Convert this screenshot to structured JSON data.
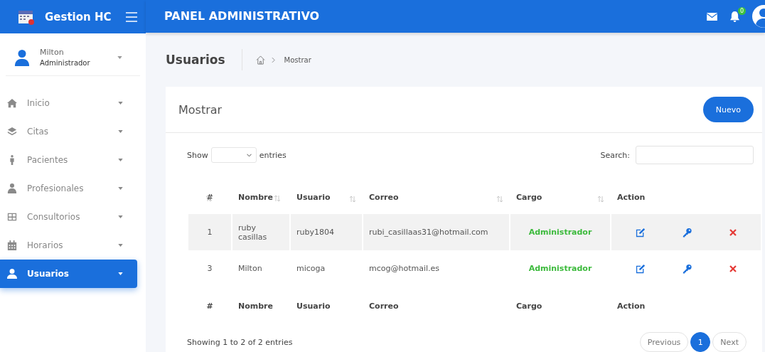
{
  "brand": "Gestion HC",
  "header": {
    "title": "PANEL ADMINISTRATIVO",
    "notifications": "0"
  },
  "user": {
    "name": "Milton",
    "role": "Administrador"
  },
  "nav": [
    {
      "label": "Inicio",
      "selected": false
    },
    {
      "label": "Citas",
      "selected": false
    },
    {
      "label": "Pacientes",
      "selected": false
    },
    {
      "label": "Profesionales",
      "selected": false
    },
    {
      "label": "Consultorios",
      "selected": false
    },
    {
      "label": "Horarios",
      "selected": false
    },
    {
      "label": "Usuarios",
      "selected": true
    }
  ],
  "page": {
    "title": "Usuarios",
    "breadcrumb": "Mostrar"
  },
  "card": {
    "title": "Mostrar",
    "button": "Nuevo"
  },
  "controls": {
    "show": "Show",
    "entries": "entries",
    "search": "Search:"
  },
  "table": {
    "columns": [
      "#",
      "Nombre",
      "Usuario",
      "Correo",
      "Cargo",
      "Action"
    ],
    "rows": [
      {
        "cells": [
          "1",
          "ruby casillas",
          "ruby1804",
          "rubi_casillaas31@hotmail.com",
          "Administrador"
        ],
        "striped": true
      },
      {
        "cells": [
          "3",
          "Milton",
          "micoga",
          "mcog@hotmail.es",
          "Administrador"
        ],
        "striped": false
      }
    ],
    "footer": [
      "#",
      "Nombre",
      "Usuario",
      "Correo",
      "Cargo",
      "Action"
    ]
  },
  "info": "Showing 1 to 2 of 2 entries",
  "pagination": [
    {
      "label": "Previous",
      "selected": false
    },
    {
      "label": "1",
      "selected": true
    },
    {
      "label": "Next",
      "selected": false
    }
  ]
}
